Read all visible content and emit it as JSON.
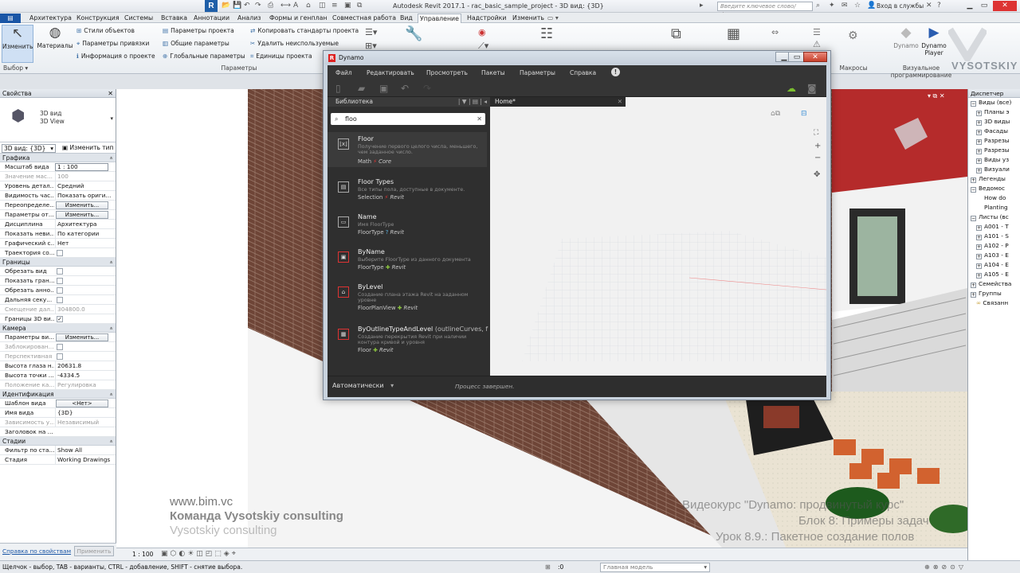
{
  "titlebar": {
    "title": "Autodesk Revit 2017.1 -   rac_basic_sample_project - 3D вид: {3D}",
    "search_placeholder": "Введите ключевое слово/фразу",
    "login": "Вход в службы"
  },
  "tabs": [
    {
      "label": "Архитектура"
    },
    {
      "label": "Конструкция"
    },
    {
      "label": "Системы"
    },
    {
      "label": "Вставка"
    },
    {
      "label": "Аннотации"
    },
    {
      "label": "Анализ"
    },
    {
      "label": "Формы и генплан"
    },
    {
      "label": "Совместная работа"
    },
    {
      "label": "Вид"
    },
    {
      "label": "Управление"
    },
    {
      "label": "Надстройки"
    },
    {
      "label": "Изменить"
    }
  ],
  "ribbon": {
    "modify": "Изменить",
    "select": "Выбор",
    "materials": "Материалы",
    "settings_col1": [
      "Стили объектов",
      "Параметры привязки",
      "Информация о проекте"
    ],
    "settings_col2": [
      "Параметры проекта",
      "Общие параметры",
      "Глобальные параметры"
    ],
    "settings_col3": [
      "Копировать стандарты проекта",
      "Удалить неиспользуемые",
      "Единицы проекта"
    ],
    "settings_panel": "Параметры",
    "macros": "Макросы",
    "visual_programming": "Визуальное программирование",
    "dynamo": "Dynamo",
    "dynamo_player": "Dynamo Player"
  },
  "properties": {
    "title": "Свойства",
    "type_line1": "3D вид",
    "type_line2": "3D View",
    "view_selector": "3D вид: {3D}",
    "edit_type": "Изменить тип",
    "sections": {
      "graphics": "Графика",
      "extents": "Границы",
      "camera": "Камера",
      "identity": "Идентификация",
      "phasing": "Стадии"
    },
    "graphics_rows": [
      {
        "k": "Масштаб вида",
        "v": "1 : 100"
      },
      {
        "k": "Значение мас...",
        "v": "100"
      },
      {
        "k": "Уровень детал...",
        "v": "Средний"
      },
      {
        "k": "Видимость час...",
        "v": "Показать ориги..."
      },
      {
        "k": "Переопределе...",
        "v": "Изменить..."
      },
      {
        "k": "Параметры от...",
        "v": "Изменить..."
      },
      {
        "k": "Дисциплина",
        "v": "Архитектура"
      },
      {
        "k": "Показать неви...",
        "v": "По категории"
      },
      {
        "k": "Графический с...",
        "v": "Нет"
      },
      {
        "k": "Траектория со...",
        "v": ""
      }
    ],
    "extents_rows": [
      {
        "k": "Обрезать вид"
      },
      {
        "k": "Показать гран..."
      },
      {
        "k": "Обрезать анно..."
      },
      {
        "k": "Дальняя секу..."
      },
      {
        "k": "Смещение дал...",
        "v": "304800.0"
      },
      {
        "k": "Границы 3D ви...",
        "v": "✓"
      }
    ],
    "camera_rows": [
      {
        "k": "Параметры ви...",
        "v": "Изменить..."
      },
      {
        "k": "Заблокирован..."
      },
      {
        "k": "Перспективная"
      },
      {
        "k": "Высота глаза н...",
        "v": "20631.8"
      },
      {
        "k": "Высота точки ...",
        "v": "-4334.5"
      },
      {
        "k": "Положение ка...",
        "v": "Регулировка"
      }
    ],
    "identity_rows": [
      {
        "k": "Шаблон вида",
        "v": "<Нет>"
      },
      {
        "k": "Имя вида",
        "v": "{3D}"
      },
      {
        "k": "Зависимость у...",
        "v": "Независимый"
      },
      {
        "k": "Заголовок на ...",
        "v": ""
      }
    ],
    "phasing_rows": [
      {
        "k": "Фильтр по ста...",
        "v": "Show All"
      },
      {
        "k": "Стадия",
        "v": "Working Drawings"
      }
    ],
    "help_link": "Справка по свойствам",
    "apply": "Применить"
  },
  "browser": {
    "title": "Диспетчер",
    "items": [
      "Виды (все)",
      "Планы э",
      "3D виды",
      "Фасады",
      "Разрезы",
      "Разрезы",
      "Виды уз",
      "Визуали",
      "Легенды",
      "Ведомос",
      "How do",
      "Planting",
      "Листы (вс",
      "A001 - T",
      "A101 - S",
      "A102 - P",
      "A103 - E",
      "A104 - E",
      "A105 - E",
      "Семейства",
      "Группы",
      "Связанн"
    ]
  },
  "watermark": {
    "site": "www.bim.vc",
    "team": "Команда Vysotskiy consulting",
    "brand": "Vysotskiy consulting",
    "logo": "VYSOTSKIY",
    "course": "Видеокурс \"Dynamo: продвинутый курс\"",
    "block": "Блок 8: Примеры задач",
    "lesson": "Урок 8.9.: Пакетное создание полов"
  },
  "dynamo": {
    "title": "Dynamo",
    "menu": [
      "Файл",
      "Редактировать",
      "Просмотреть",
      "Пакеты",
      "Параметры",
      "Справка"
    ],
    "library_title": "Библиотека",
    "search_value": "floo",
    "home_tab": "Home*",
    "run_mode": "Автоматически",
    "run_status": "Процесс завершен.",
    "results": [
      {
        "name": "Floor",
        "desc": "Получение первого целого числа, меньшего, чем заданное число.",
        "cat": "Math",
        "lib": "Core",
        "icon": "⌊x⌋"
      },
      {
        "name": "Floor Types",
        "desc": "Все типы пола, доступные в документе.",
        "cat": "Selection",
        "lib": "Revit",
        "icon": "▤"
      },
      {
        "name": "Name",
        "desc": "Имя FloorType",
        "cat": "FloorType",
        "lib": "Revit",
        "icon": "▭"
      },
      {
        "name": "ByName",
        "desc": "Выберите FloorType из данного документа",
        "cat": "FloorType",
        "lib": "Revit",
        "icon": "▣"
      },
      {
        "name": "ByLevel",
        "desc": "Создание плана этажа Revit на заданном уровне",
        "cat": "FloorPlanView",
        "lib": "Revit",
        "icon": "⌂"
      },
      {
        "name": "ByOutlineTypeAndLevel",
        "params": " (outlineCurves, f",
        "desc": "Создание перекрытия Revit при наличии контура кривой и уровня",
        "cat": "Floor",
        "lib": "Revit",
        "icon": "▦"
      }
    ]
  },
  "viewbar": {
    "scale": "1 : 100"
  },
  "statusbar": {
    "message": "Щелчок - выбор, TAB - варианты, CTRL - добавление, SHIFT - снятие выбора.",
    "zero": ":0",
    "model": "Главная модель"
  },
  "colors": {
    "revit_blue": "#1a56a6",
    "dynamo_bg": "#2b2b2b",
    "roof_red": "#c0262c",
    "brick": "#6b4234"
  }
}
